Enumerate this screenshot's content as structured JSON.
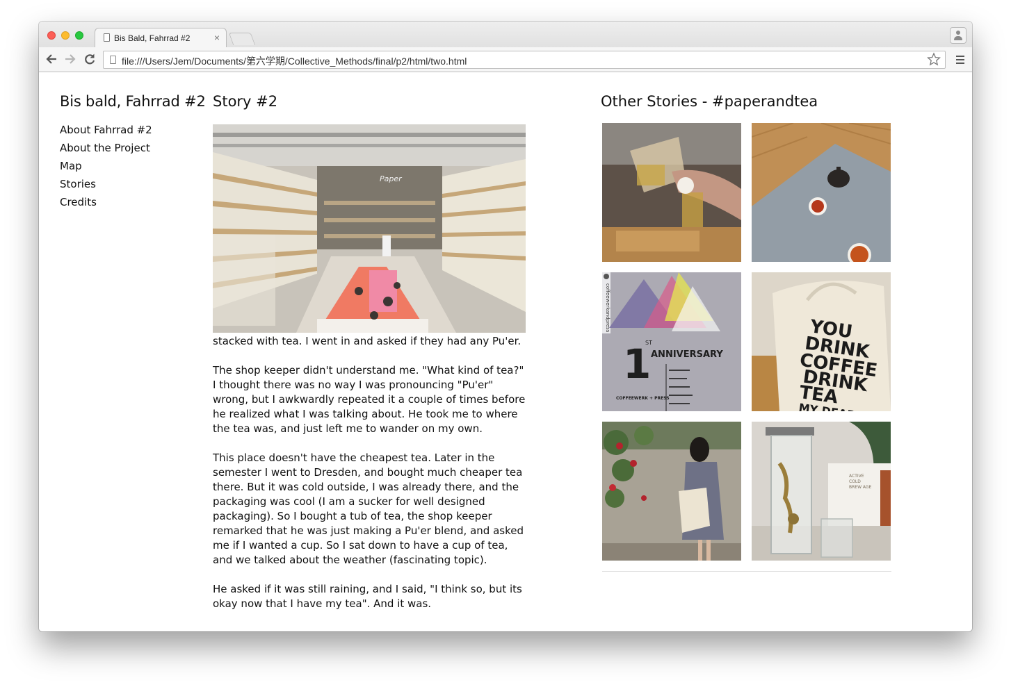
{
  "browser": {
    "tab_title": "Bis Bald, Fahrrad #2",
    "tab_close": "×",
    "url": "file:///Users/Jem/Documents/第六学期/Collective_Methods/final/p2/html/two.html",
    "icons": [
      "back-arrow-icon",
      "forward-arrow-icon",
      "reload-icon",
      "page-icon",
      "bookmark-star-icon",
      "menu-icon",
      "profile-icon"
    ]
  },
  "site": {
    "title": "Bis bald, Fahrrad #2",
    "nav": [
      "About Fahrrad #2",
      "About the Project",
      "Map",
      "Stories",
      "Credits"
    ]
  },
  "story": {
    "title": "Story #2",
    "image_alt": "Tea shop interior with shelves stacked with tea",
    "shop_sign": "Paper",
    "paragraphs": [
      "the right signs: warm lights, bright interiors, and walls stacked with tea. I went in and asked if they had any Pu'er.",
      "The shop keeper didn't understand me. \"What kind of tea?\" I thought there was no way I was pronouncing \"Pu'er\" wrong, but I awkwardly repeated it a couple of times before he realized what I was talking about. He took me to where the tea was, and just left me to wander on my own.",
      "This place doesn't have the cheapest tea. Later in the semester I went to Dresden, and bought much cheaper tea there. But it was cold outside, I was already there, and the packaging was cool (I am a sucker for well designed packaging). So I bought a tub of tea, the shop keeper remarked that he was just making a Pu'er blend, and asked me if I wanted a cup. So I sat down to have a cup of tea, and we talked about the weather (fascinating topic).",
      "He asked if it was still raining, and I said, \"I think so, but its okay now that I have my tea\". And it was."
    ]
  },
  "others": {
    "title": "Other Stories - #paperandtea",
    "thumbs": [
      {
        "name": "pouring-tea"
      },
      {
        "name": "teapot-table"
      },
      {
        "name": "anniversary-poster",
        "text": {
          "handle": "coffeewerkandpress",
          "num": "1",
          "sup": "ST",
          "word": "ANNIVERSARY",
          "brand": "COFFEEWERK + PRESS"
        }
      },
      {
        "name": "tote-bag",
        "text": {
          "line1": "YOU",
          "line2": "DRINK",
          "line3": "COFFEE",
          "line4": "DRINK",
          "line5": "TEA",
          "line6": "MY DEAR"
        }
      },
      {
        "name": "girl-with-tote"
      },
      {
        "name": "cold-brew-pitcher",
        "text": {
          "box1": "ACTIVE",
          "box2": "COLD",
          "box3": "BREW AGE"
        }
      }
    ]
  }
}
